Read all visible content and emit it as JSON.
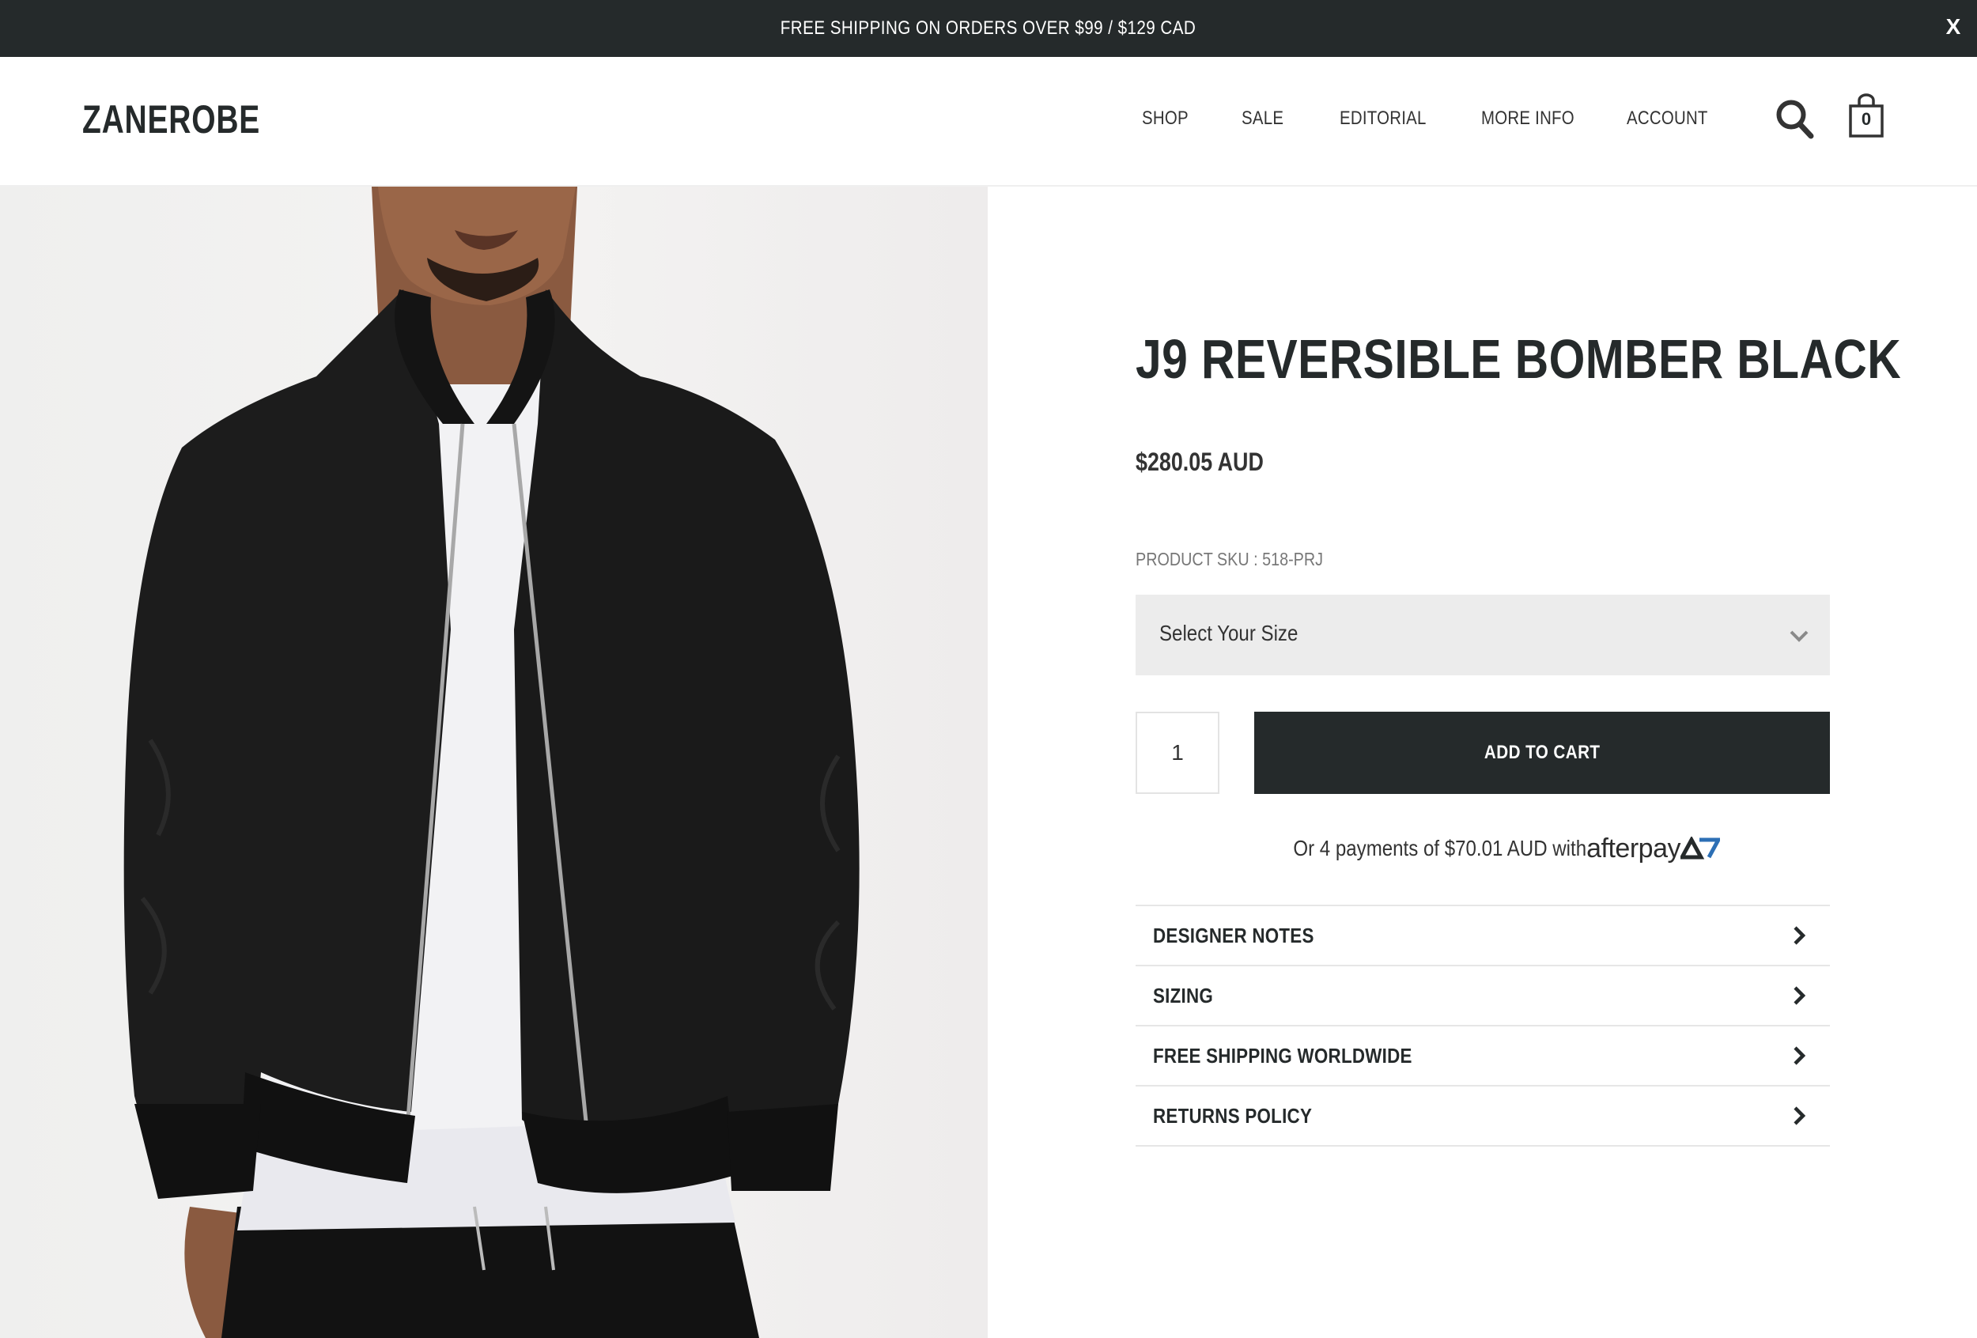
{
  "announcement": {
    "text": "FREE SHIPPING ON ORDERS OVER $99 / $129 CAD",
    "close_label": "X"
  },
  "header": {
    "logo": "ZANEROBE",
    "nav": [
      "SHOP",
      "SALE",
      "EDITORIAL",
      "MORE INFO",
      "ACCOUNT"
    ],
    "cart_count": "0",
    "icons": [
      "search-icon",
      "cart-bag-icon"
    ]
  },
  "product": {
    "title": "J9 REVERSIBLE BOMBER BLACK",
    "price": "$280.05 AUD",
    "sku": "PRODUCT SKU : 518-PRJ",
    "size_select": "Select Your Size",
    "quantity": "1",
    "add_to_cart": "ADD TO CART",
    "afterpay": {
      "text": "Or 4 payments of $70.01 AUD with",
      "logo_word_a": "afterpay",
      "logo_word_b": ""
    },
    "accordion": [
      {
        "label": "DESIGNER NOTES"
      },
      {
        "label": "SIZING"
      },
      {
        "label": "FREE SHIPPING WORLDWIDE"
      },
      {
        "label": "RETURNS POLICY"
      }
    ]
  },
  "colors": {
    "dark": "#252a2b",
    "select_bg": "#ececec",
    "afterpay_blue": "#2c6fb5"
  }
}
